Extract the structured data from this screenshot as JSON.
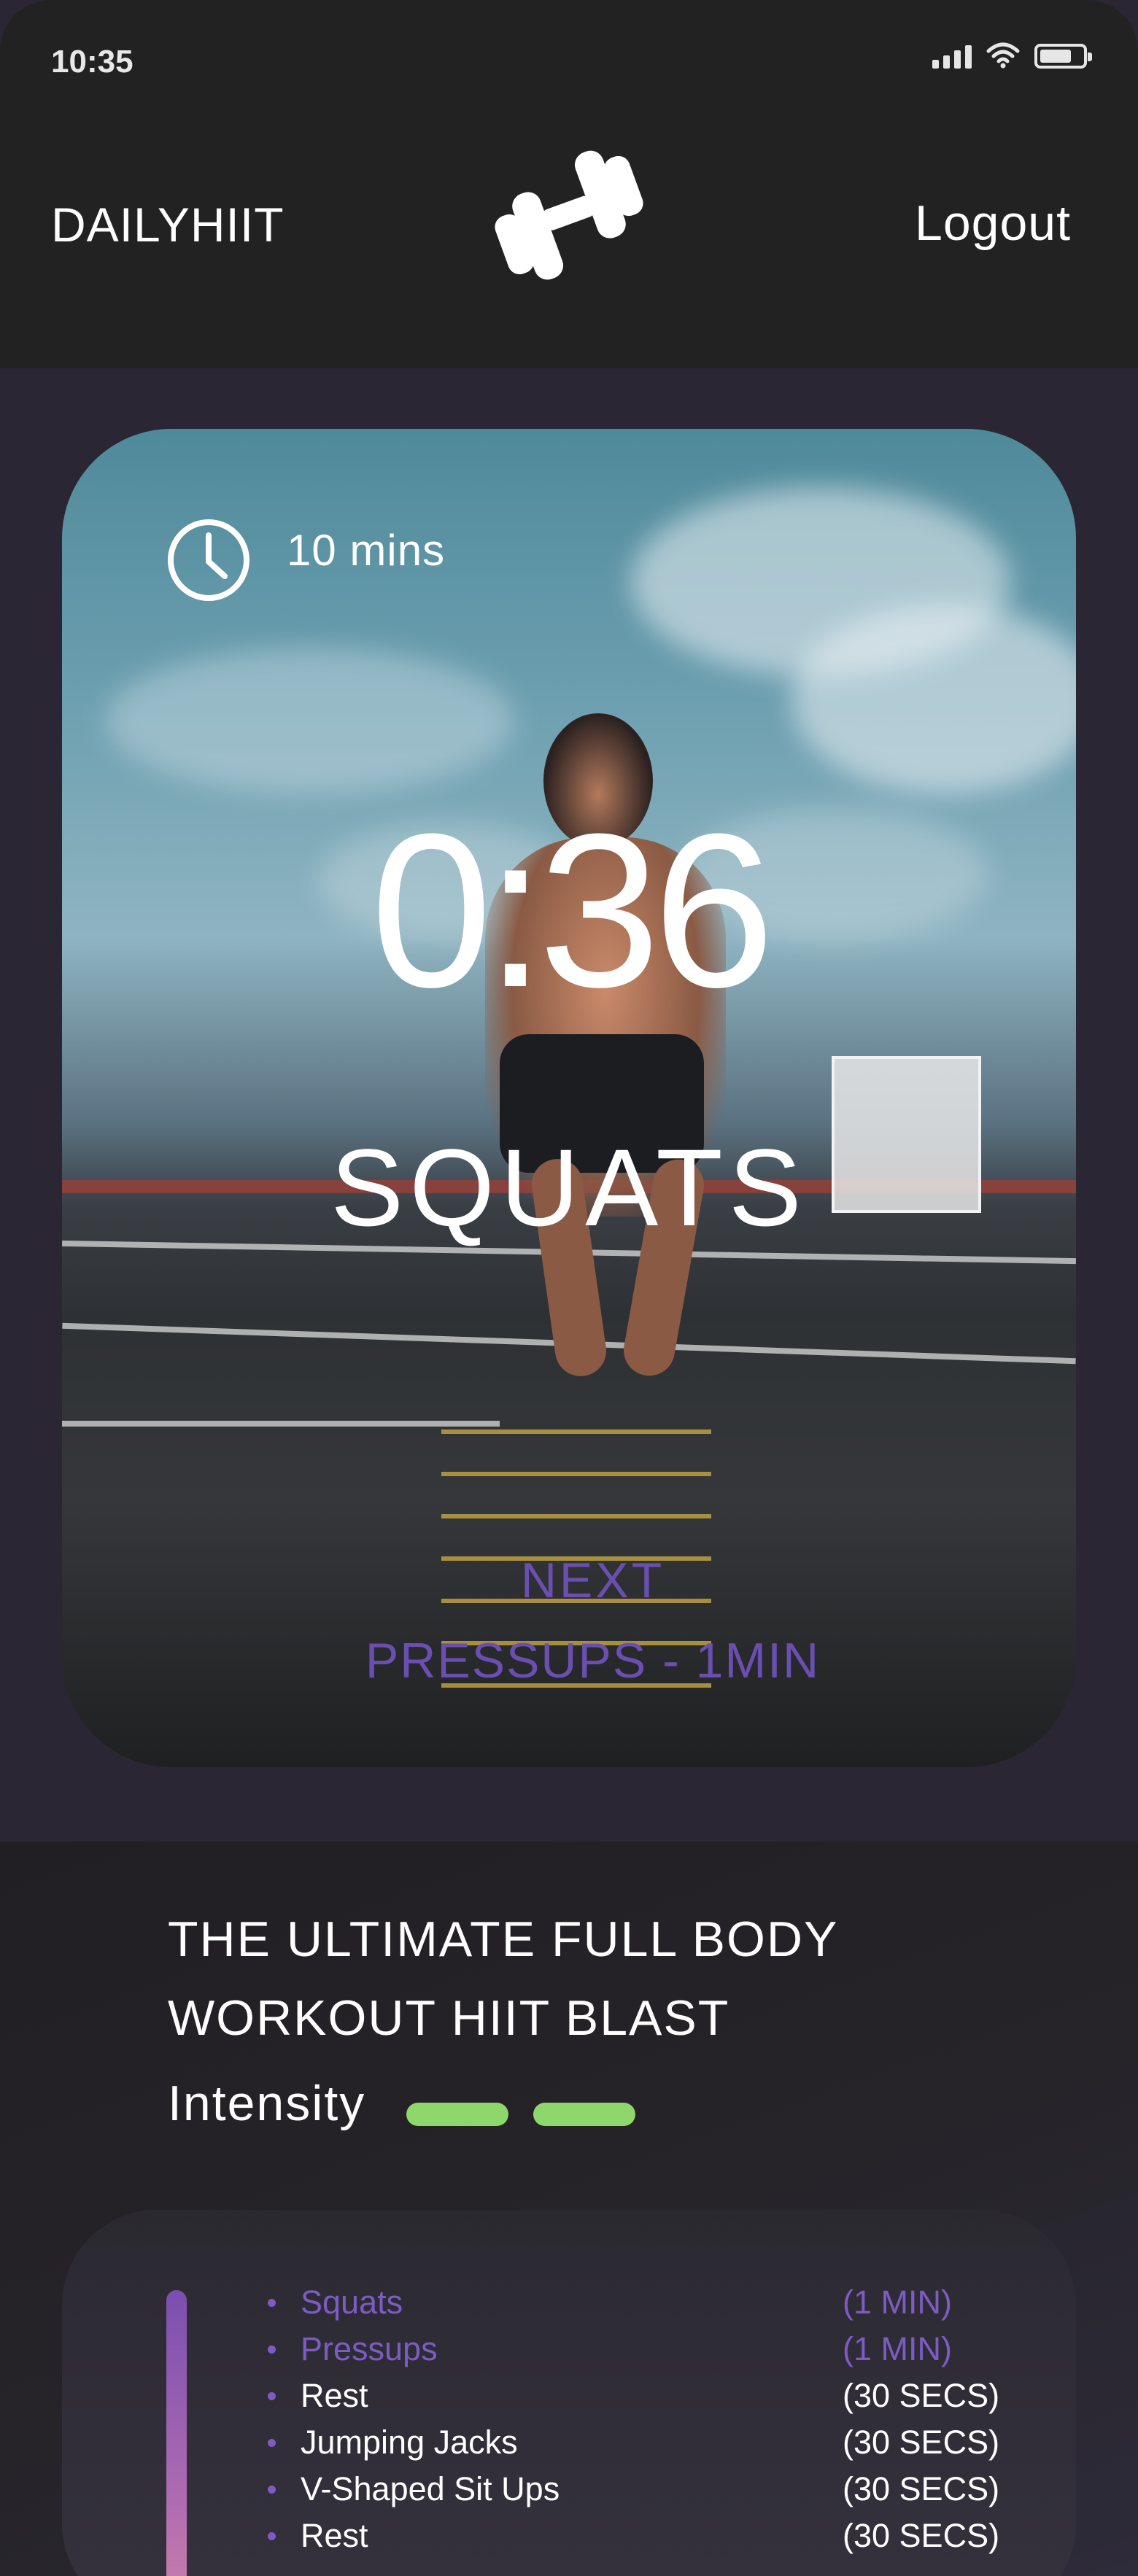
{
  "status_bar": {
    "time": "10:35"
  },
  "header": {
    "brand": "DAILYHIIT",
    "logo_icon": "dumbbell-icon",
    "logout_label": "Logout"
  },
  "hero": {
    "duration_icon": "clock-icon",
    "duration": "10 mins",
    "timer": "0:36",
    "current_exercise": "SQUATS",
    "next_label": "NEXT",
    "next_exercise": "PRESSUPS - 1MIN"
  },
  "workout": {
    "title_line1": "THE ULTIMATE FULL BODY",
    "title_line2": "WORKOUT HIIT BLAST",
    "intensity_label": "Intensity",
    "intensity_level": 2,
    "intensity_color": "#8ed76a",
    "exercises": [
      {
        "name": "Squats",
        "duration": "(1 MIN)",
        "highlight": true
      },
      {
        "name": "Pressups",
        "duration": "(1 MIN)",
        "highlight": true
      },
      {
        "name": "Rest",
        "duration": "(30 SECS)",
        "highlight": false
      },
      {
        "name": "Jumping Jacks",
        "duration": "(30 SECS)",
        "highlight": false
      },
      {
        "name": "V-Shaped Sit Ups",
        "duration": "(30 SECS)",
        "highlight": false
      },
      {
        "name": "Rest",
        "duration": "(30 SECS)",
        "highlight": false
      }
    ]
  },
  "colors": {
    "accent_purple": "#6b4fb0",
    "highlight_purple": "#7c5cc4",
    "header_bg": "#232223",
    "page_bg": "#2a2633"
  }
}
